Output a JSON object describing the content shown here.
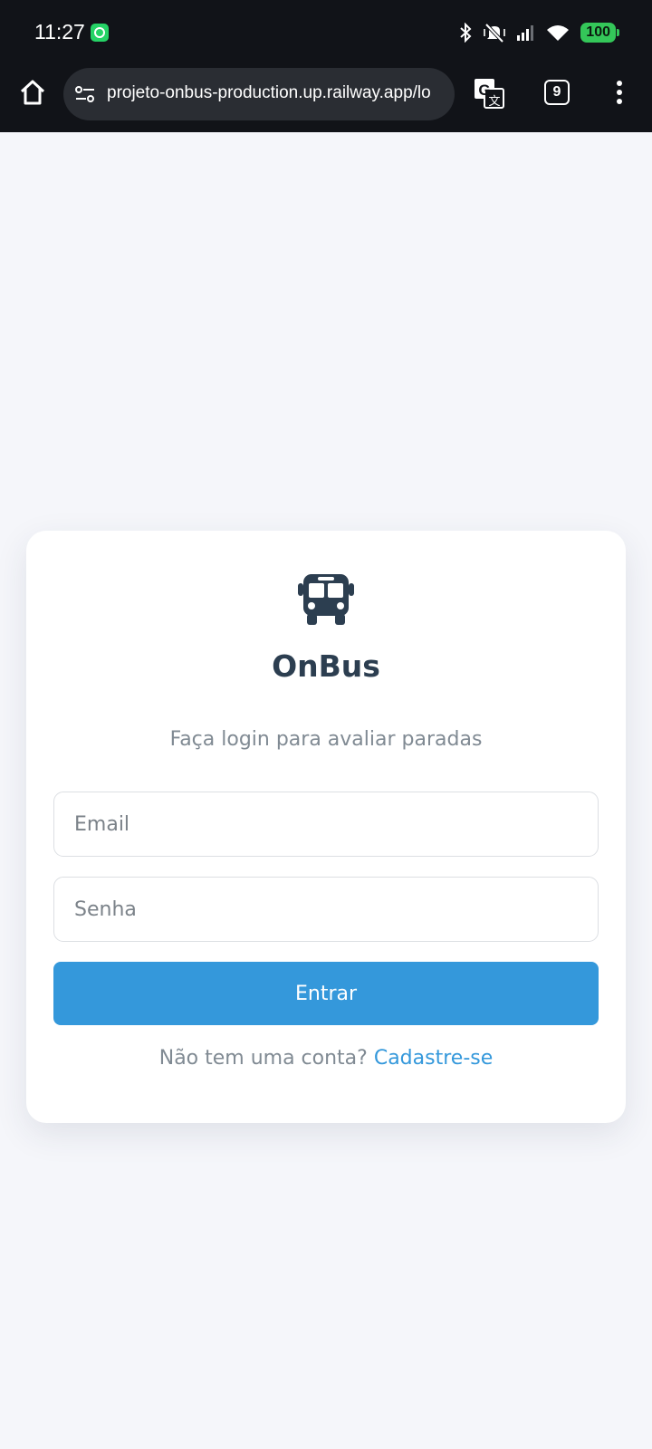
{
  "status_bar": {
    "time": "11:27",
    "notification_icon": "whatsapp-icon",
    "icons": [
      "bluetooth-icon",
      "mute-vibrate-icon",
      "signal-icon",
      "wifi-icon"
    ],
    "battery": "100"
  },
  "browser": {
    "url": "projeto-onbus-production.up.railway.app/lo",
    "tab_count": "9",
    "icons": [
      "home-icon",
      "site-settings-icon",
      "translate-icon",
      "tabs-icon",
      "more-icon"
    ]
  },
  "login": {
    "brand_icon": "bus-icon",
    "brand": "OnBus",
    "subtitle": "Faça login para avaliar paradas",
    "email_placeholder": "Email",
    "password_placeholder": "Senha",
    "submit_label": "Entrar",
    "signup_prompt": "Não tem uma conta?",
    "signup_link": "Cadastre-se"
  },
  "colors": {
    "brand_text": "#2c3e50",
    "primary_button": "#3498db",
    "link": "#3498db",
    "page_background": "#f5f6fa",
    "browser_chrome": "#111318",
    "battery": "#34c759"
  }
}
